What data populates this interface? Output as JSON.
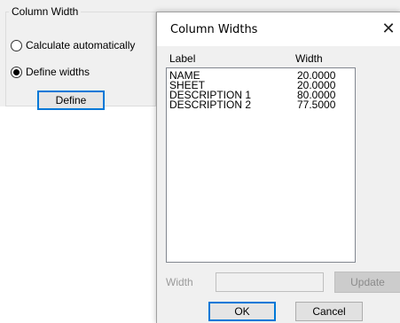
{
  "background_panel": {
    "group_title": "Column Width",
    "radio_options": [
      {
        "label": "Calculate automatically",
        "selected": false
      },
      {
        "label": "Define widths",
        "selected": true
      }
    ],
    "define_label": "Define"
  },
  "dialog": {
    "title": "Column Widths",
    "close_glyph": "✕",
    "columns": {
      "label": "Label",
      "width": "Width"
    },
    "rows": [
      {
        "label": "NAME",
        "width": "20.0000"
      },
      {
        "label": "SHEET",
        "width": "20.0000"
      },
      {
        "label": "DESCRIPTION 1",
        "width": "80.0000"
      },
      {
        "label": "DESCRIPTION 2",
        "width": "77.5000"
      }
    ],
    "width_field_label": "Width",
    "width_value": "",
    "update_label": "Update",
    "ok_label": "OK",
    "cancel_label": "Cancel"
  },
  "colors": {
    "accent": "#0078d7",
    "disabled_text": "#9b9b9b"
  }
}
